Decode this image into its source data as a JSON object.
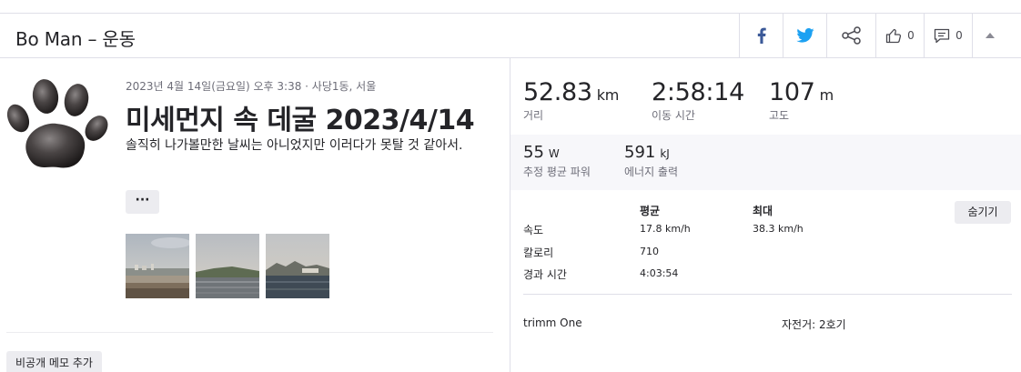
{
  "header": {
    "title": "Bo Man – 운동",
    "kudos_count": "0",
    "comment_count": "0"
  },
  "activity": {
    "meta": "2023년 4월 14일(금요일) 오후 3:38 · 사당1동, 서울",
    "title": "미세먼지 속 데굴 2023/4/14",
    "description": "솔직히 나가볼만한 날씨는 아니었지만 이러다가 못탈 것 같아서.",
    "more_label": "···",
    "private_note_label": "비공개 메모 추가"
  },
  "stats": {
    "distance": {
      "value": "52.83",
      "unit": "km",
      "label": "거리"
    },
    "moving_time": {
      "value": "2:58:14",
      "label": "이동 시간"
    },
    "elevation": {
      "value": "107",
      "unit": "m",
      "label": "고도"
    },
    "power": {
      "value": "55",
      "unit": "W",
      "label": "추정 평균 파워"
    },
    "energy": {
      "value": "591",
      "unit": "kJ",
      "label": "에너지 출력"
    }
  },
  "details_table": {
    "col_avg": "평균",
    "col_max": "최대",
    "hide_label": "숨기기",
    "rows": [
      {
        "label": "속도",
        "avg": "17.8 km/h",
        "max": "38.3 km/h"
      },
      {
        "label": "칼로리",
        "avg": "710",
        "max": ""
      },
      {
        "label": "경과 시간",
        "avg": "4:03:54",
        "max": ""
      }
    ]
  },
  "gear": {
    "device": "trimm One",
    "bike": "자전거: 2호기"
  },
  "colors": {
    "facebook": "#3b5998",
    "twitter": "#1da1f2",
    "border": "#dfdfe8",
    "secondary_bg": "#f7f7fa",
    "button_bg": "#ececf0"
  },
  "icons": [
    "facebook-icon",
    "twitter-icon",
    "share-icon",
    "thumbs-up-icon",
    "comment-icon",
    "chevron-up-icon",
    "paw-avatar-icon"
  ]
}
